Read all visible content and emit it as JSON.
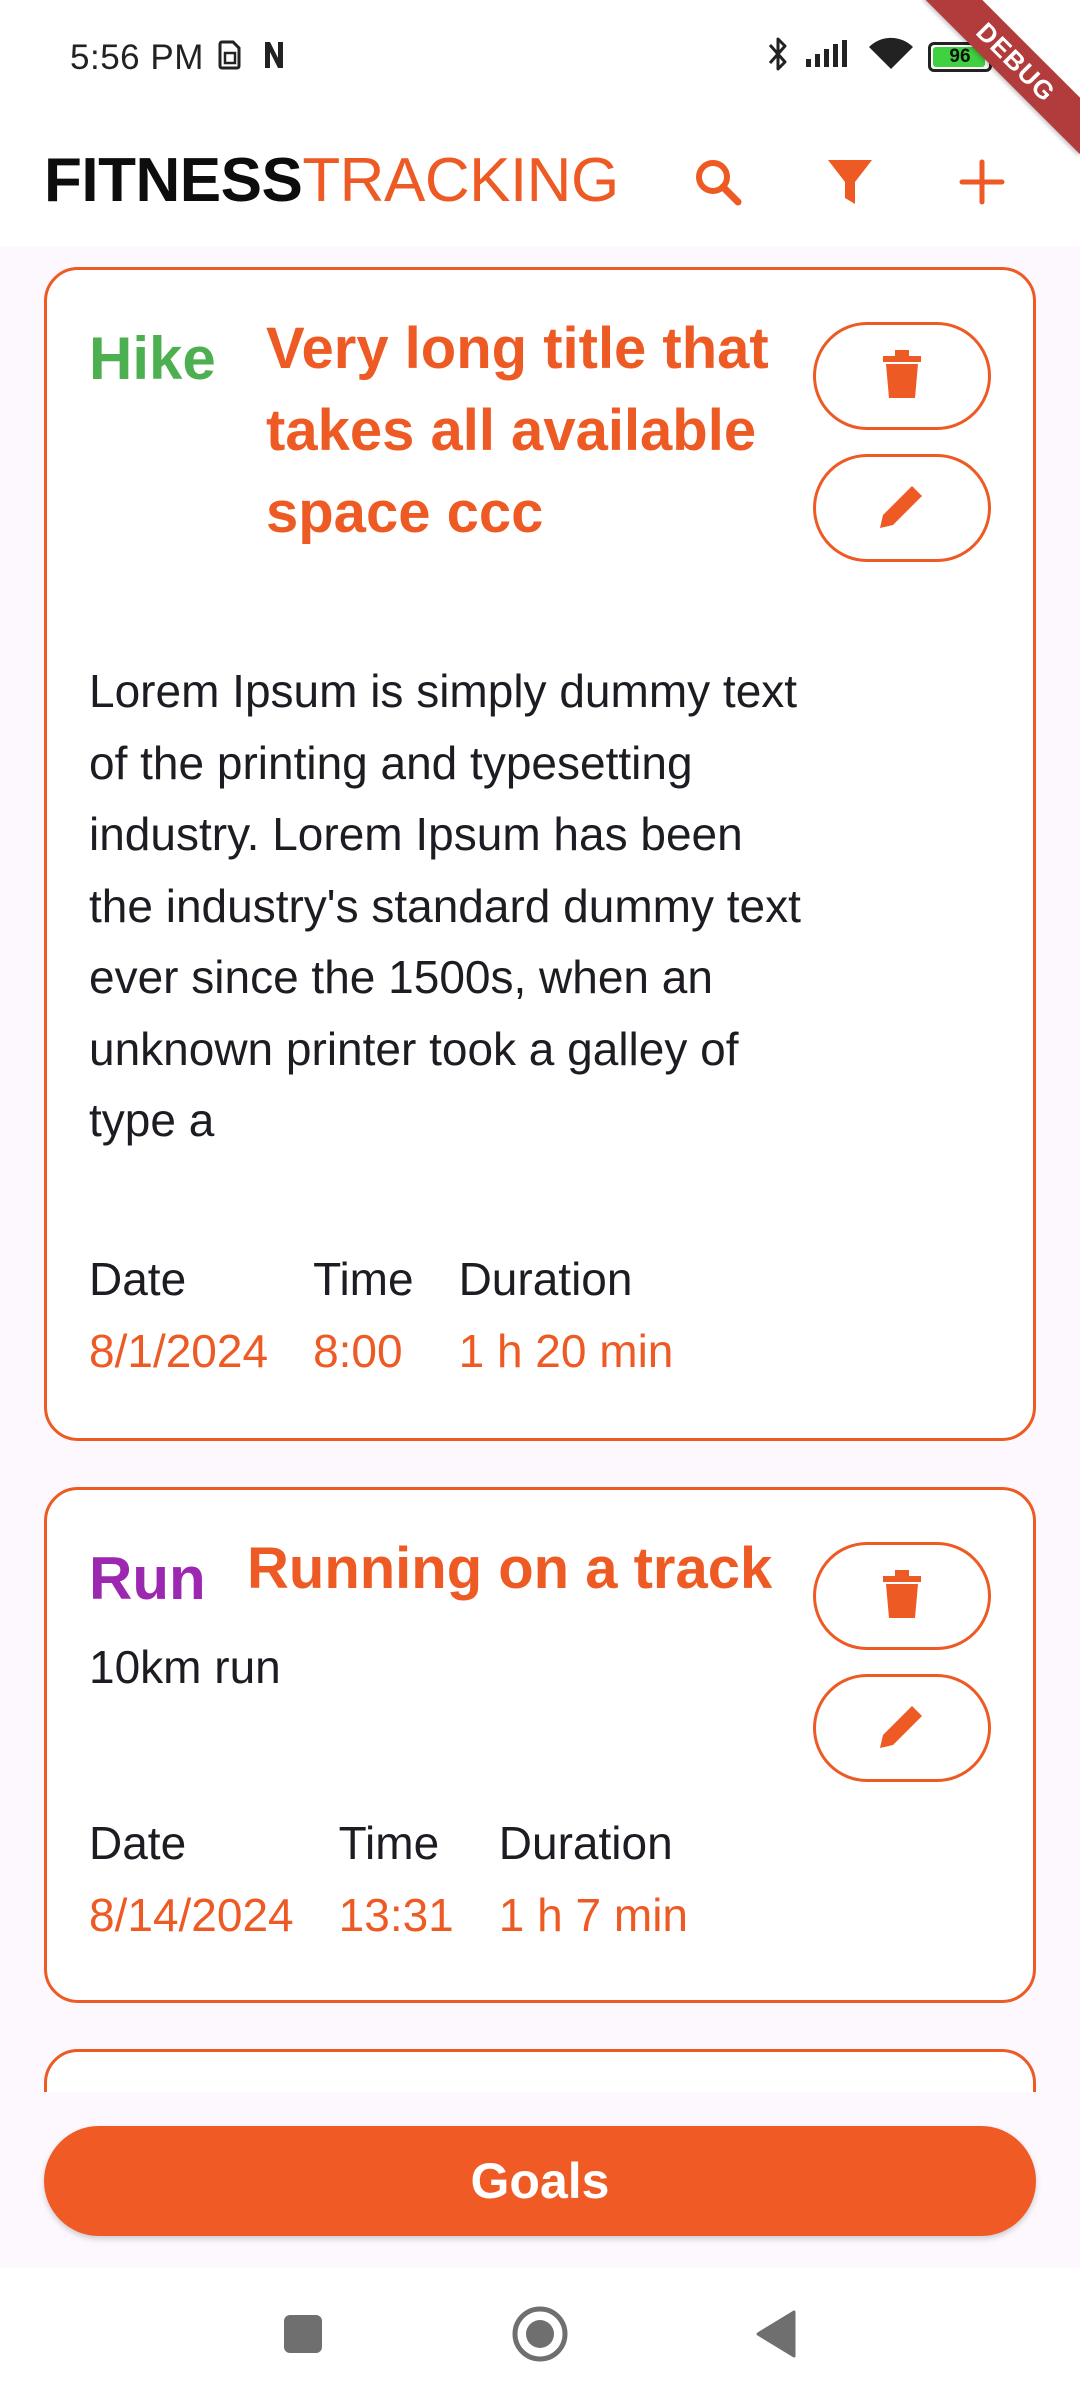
{
  "status_bar": {
    "time": "5:56 PM",
    "battery": "96",
    "battery_level": 0.96,
    "icons": [
      "sim-icon",
      "notification-n-icon",
      "bluetooth-icon",
      "signal-icon",
      "wifi-icon",
      "battery-icon"
    ]
  },
  "debug_banner": "DEBUG",
  "app_bar": {
    "title_bold": "FITNESS",
    "title_light": "TRACKING",
    "actions": [
      "search-icon",
      "filter-icon",
      "add-icon"
    ]
  },
  "activities": [
    {
      "type": "Hike",
      "type_color": "#4caf50",
      "title": "Very long title that takes all available space ccc",
      "description": "Lorem Ipsum is simply dummy text of the printing and typesetting industry. Lorem Ipsum has been the industry's standard dummy text ever since the 1500s, when an unknown printer took a galley of type a",
      "date_label": "Date",
      "date": "8/1/2024",
      "time_label": "Time",
      "time": "8:00",
      "duration_label": "Duration",
      "duration": "1 h 20 min"
    },
    {
      "type": "Run",
      "type_color": "#9c27b0",
      "title": "Running on a track",
      "description": "10km run",
      "date_label": "Date",
      "date": "8/14/2024",
      "time_label": "Time",
      "time": "13:31",
      "duration_label": "Duration",
      "duration": "1 h 7 min"
    }
  ],
  "goals_button": "Goals",
  "colors": {
    "accent": "#ee5a24",
    "background": "#fdf7fe",
    "hike": "#4caf50",
    "run": "#9c27b0"
  }
}
